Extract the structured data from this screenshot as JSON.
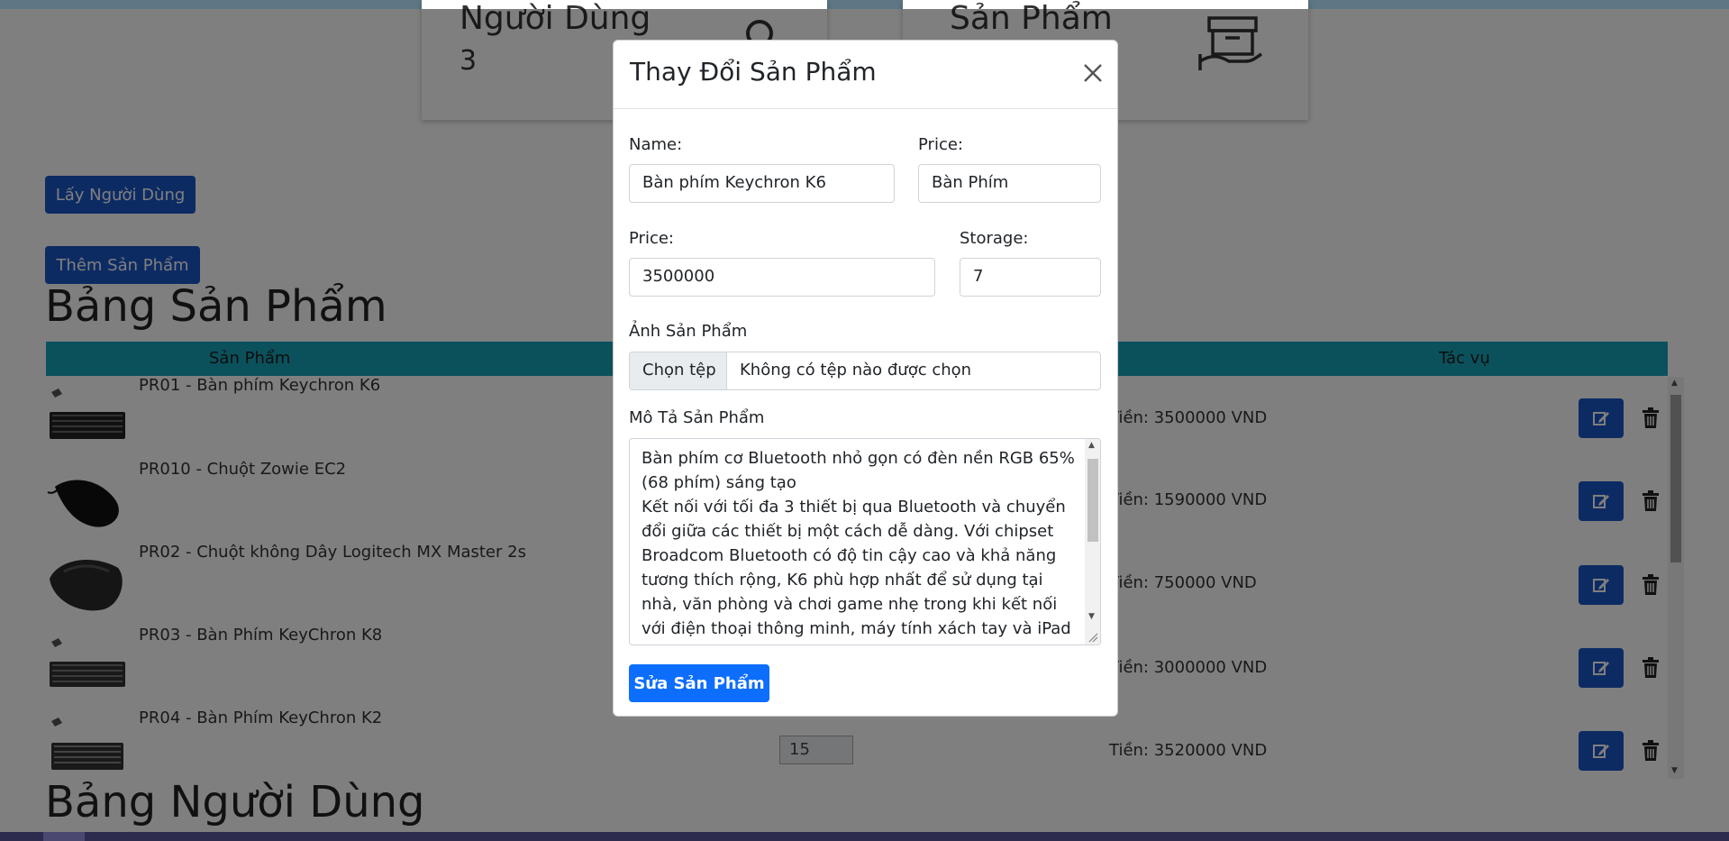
{
  "stats": {
    "users": {
      "label": "Người Dùng",
      "count": "3"
    },
    "products": {
      "label": "Sản Phẩm"
    }
  },
  "buttons": {
    "get_users": "Lấy Người Dùng",
    "add_product": "Thêm Sản Phẩm"
  },
  "product_table": {
    "title": "Bảng Sản Phẩm",
    "columns": [
      "Sản Phẩm",
      "Tác vụ"
    ],
    "rows": [
      {
        "name": "PR01 - Bàn phím Keychron K6",
        "price": "Tiền: 3500000 VND"
      },
      {
        "name": "PR010 - Chuột Zowie EC2",
        "price": "Tiền: 1590000 VND"
      },
      {
        "name": "PR02  - Chuột không Dây Logitech MX Master 2s",
        "price": "Tiền: 750000 VND"
      },
      {
        "name": "PR03  - Bàn Phím KeyChron K8",
        "price": "Tiền: 3000000 VND"
      },
      {
        "name": "PR04  - Bàn Phím KeyChron K2",
        "price": "Tiền: 3520000 VND",
        "qty": "15"
      }
    ]
  },
  "user_table": {
    "title": "Bảng Người Dùng"
  },
  "modal": {
    "title": "Thay Đổi Sản Phẩm",
    "name_label": "Name:",
    "name_value": "Bàn phím Keychron K6",
    "category_label": "Price:",
    "category_value": "Bàn Phím",
    "price_label": "Price:",
    "price_value": "3500000",
    "storage_label": "Storage:",
    "storage_value": "7",
    "image_label": "Ảnh Sản Phẩm",
    "file_button": "Chọn tệp",
    "file_none": "Không có tệp nào được chọn",
    "desc_label": "Mô Tả Sản Phẩm",
    "desc_value": "Bàn phím cơ Bluetooth nhỏ gọn có đèn nền RGB 65% (68 phím) sáng tạo\nKết nối với tối đa 3 thiết bị qua Bluetooth và chuyển đổi giữa các thiết bị một cách dễ dàng. Với chipset Broadcom Bluetooth có độ tin cậy cao và khả năng tương thích rộng, K6 phù hợp nhất để sử dụng tại nhà, văn phòng và chơi game nhẹ trong khi kết nối với điện thoại thông minh, máy tính xách tay và iPad",
    "submit": "Sửa Sản Phẩm"
  }
}
